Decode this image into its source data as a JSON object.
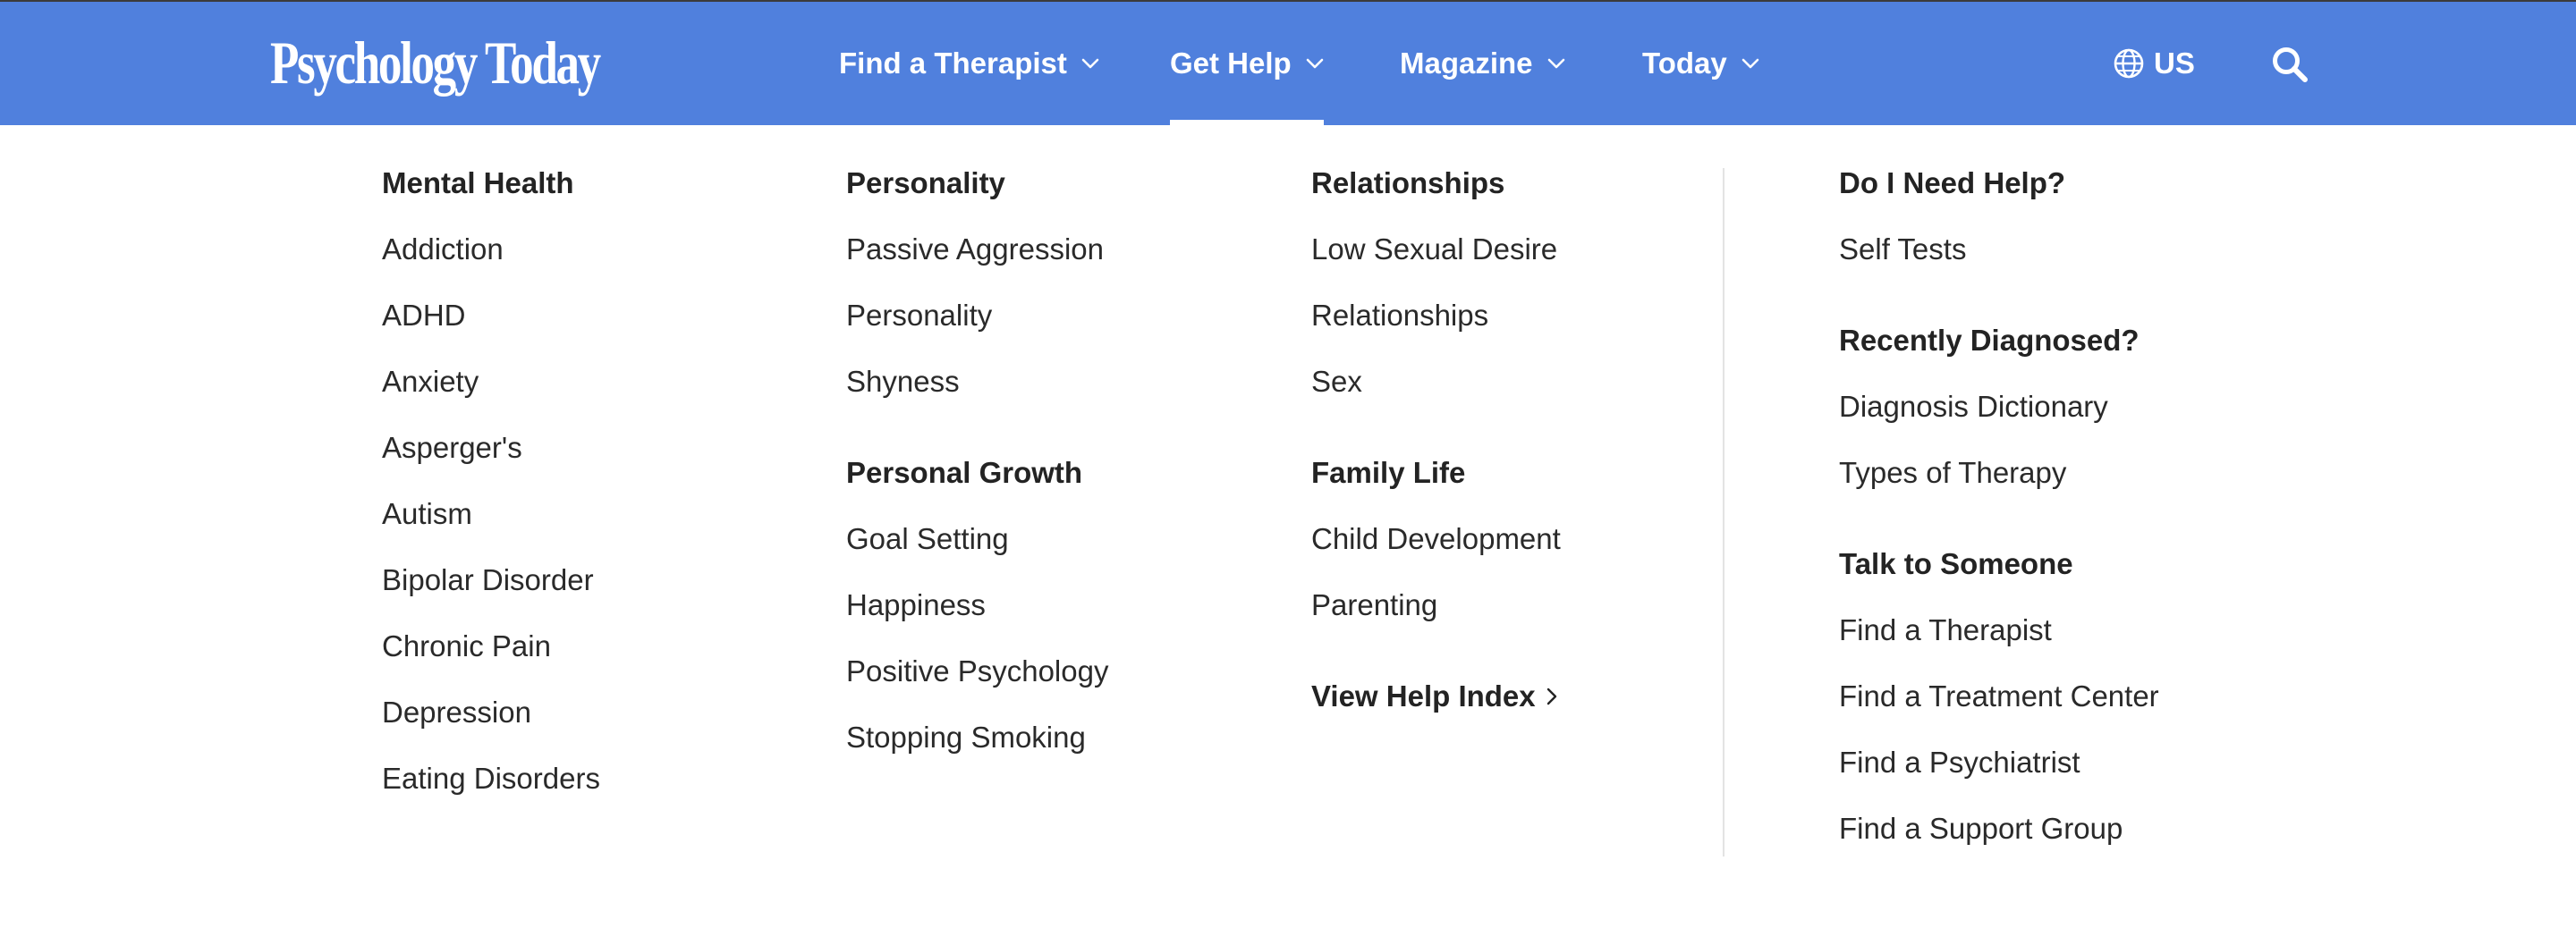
{
  "header": {
    "logo_text": "Psychology Today",
    "nav": [
      {
        "label": "Find a Therapist"
      },
      {
        "label": "Get Help"
      },
      {
        "label": "Magazine"
      },
      {
        "label": "Today"
      }
    ],
    "active_nav": "Get Help",
    "locale": "US",
    "background_color": "#5080dd"
  },
  "menu": {
    "col1": {
      "heading": "Mental Health",
      "links": [
        "Addiction",
        "ADHD",
        "Anxiety",
        "Asperger's",
        "Autism",
        "Bipolar Disorder",
        "Chronic Pain",
        "Depression",
        "Eating Disorders"
      ]
    },
    "col2": {
      "heading1": "Personality",
      "links1": [
        "Passive Aggression",
        "Personality",
        "Shyness"
      ],
      "heading2": "Personal Growth",
      "links2": [
        "Goal Setting",
        "Happiness",
        "Positive Psychology",
        "Stopping Smoking"
      ]
    },
    "col3": {
      "heading1": "Relationships",
      "links1": [
        "Low Sexual Desire",
        "Relationships",
        "Sex"
      ],
      "heading2": "Family Life",
      "links2": [
        "Child Development",
        "Parenting"
      ],
      "view_index": "View Help Index"
    },
    "col4": {
      "heading1": "Do I Need Help?",
      "links1": [
        "Self Tests"
      ],
      "heading2": "Recently Diagnosed?",
      "links2": [
        "Diagnosis Dictionary",
        "Types of Therapy"
      ],
      "heading3": "Talk to Someone",
      "links3": [
        "Find a Therapist",
        "Find a Treatment Center",
        "Find a Psychiatrist",
        "Find a Support Group"
      ]
    }
  }
}
